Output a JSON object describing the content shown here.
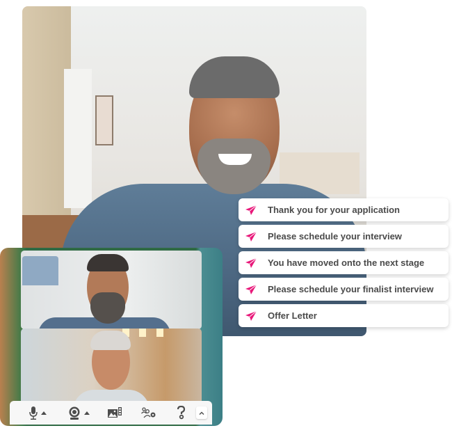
{
  "messages": [
    {
      "label": "Thank you for your application",
      "icon": "paper-plane-icon"
    },
    {
      "label": "Please schedule your interview",
      "icon": "paper-plane-icon"
    },
    {
      "label": "You have moved onto the next stage",
      "icon": "paper-plane-icon"
    },
    {
      "label": "Please schedule your finalist interview",
      "icon": "paper-plane-icon"
    },
    {
      "label": "Offer Letter",
      "icon": "paper-plane-icon"
    }
  ],
  "colors": {
    "accent": "#e8187a",
    "text": "#4a4a4a",
    "toolbar_icon": "#4d4d4d"
  },
  "toolbar": {
    "buttons": [
      {
        "name": "microphone",
        "icon": "microphone-icon",
        "has_menu": true
      },
      {
        "name": "camera",
        "icon": "webcam-icon",
        "has_menu": true
      },
      {
        "name": "background",
        "icon": "background-image-icon",
        "has_menu": false
      },
      {
        "name": "participants-settings",
        "icon": "participants-settings-icon",
        "has_menu": false
      },
      {
        "name": "help",
        "icon": "help-icon",
        "has_menu": false
      },
      {
        "name": "collapse",
        "icon": "chevron-up-icon",
        "has_menu": false
      }
    ]
  }
}
